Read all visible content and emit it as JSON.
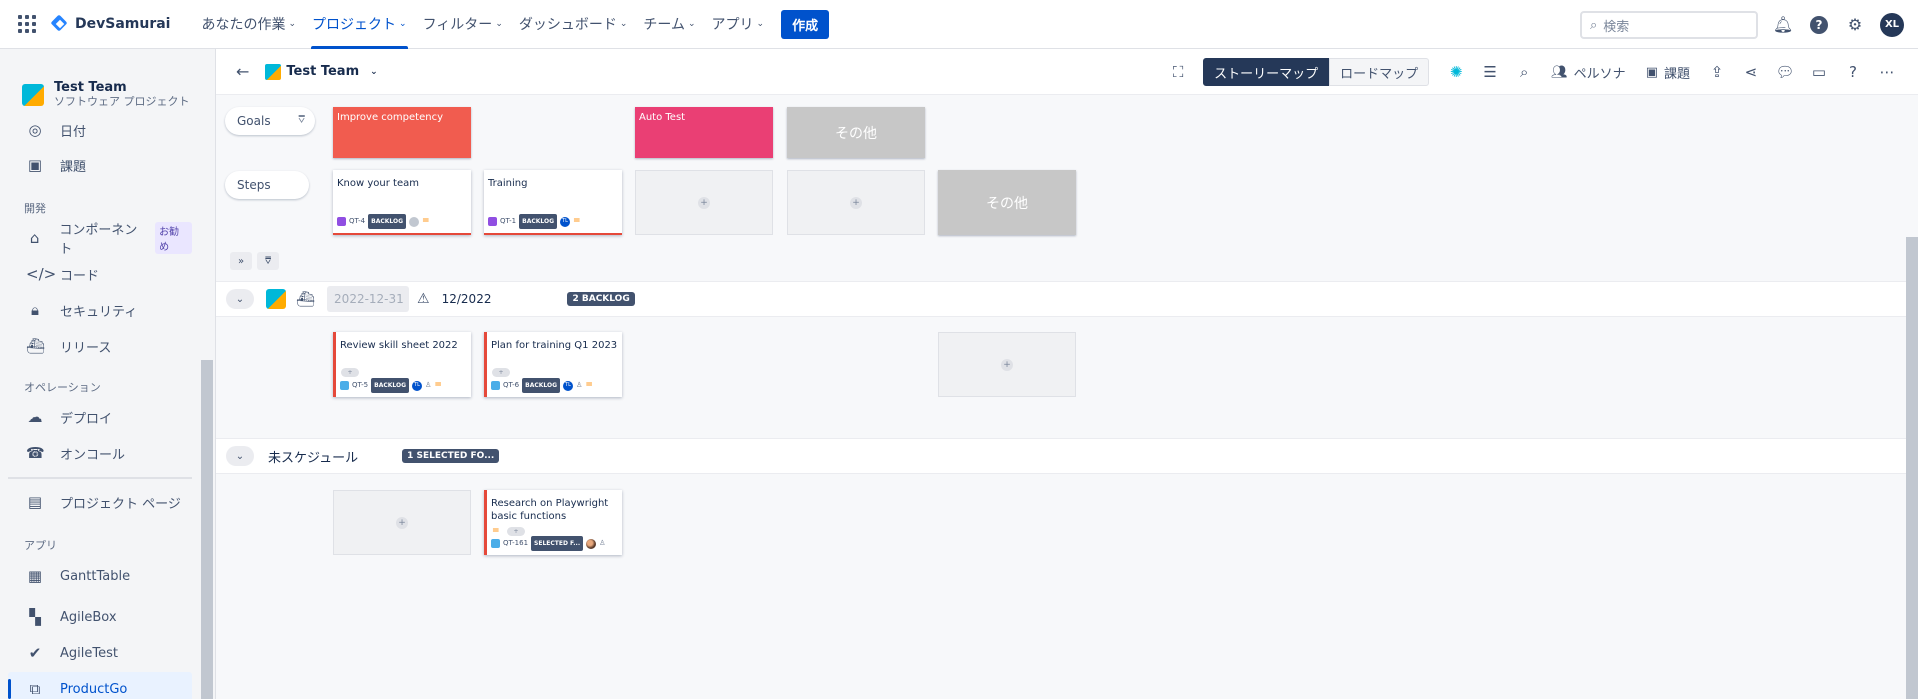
{
  "topnav": {
    "brand": "DevSamurai",
    "items": [
      {
        "label": "あなたの作業",
        "active": false
      },
      {
        "label": "プロジェクト",
        "active": true
      },
      {
        "label": "フィルター",
        "active": false
      },
      {
        "label": "ダッシュボード",
        "active": false
      },
      {
        "label": "チーム",
        "active": false
      },
      {
        "label": "アプリ",
        "active": false
      }
    ],
    "create_label": "作成",
    "search_placeholder": "検索",
    "avatar_initials": "XL"
  },
  "sidebar": {
    "project_name": "Test Team",
    "project_type": "ソフトウェア プロジェクト",
    "items": {
      "timeline": "日付",
      "issues": "課題",
      "section_dev": "開発",
      "components": "コンポーネント",
      "components_badge": "お勧め",
      "code": "コード",
      "security": "セキュリティ",
      "releases": "リリース",
      "section_ops": "オペレーション",
      "deployments": "デプロイ",
      "oncall": "オンコール",
      "project_pages": "プロジェクト ページ",
      "section_apps": "アプリ",
      "gantt": "GanttTable",
      "agilebox": "AgileBox",
      "agiletest": "AgileTest",
      "productgo": "ProductGo"
    }
  },
  "header": {
    "project_name": "Test Team",
    "view_storymap": "ストーリーマップ",
    "view_roadmap": "ロードマップ",
    "persona_label": "ペルソナ",
    "issues_label": "課題"
  },
  "board": {
    "goals_label": "Goals",
    "steps_label": "Steps",
    "other_label": "その他",
    "goals": [
      {
        "title": "Improve competency",
        "color": "#f15c4f"
      },
      {
        "title": "Auto Test",
        "color": "#ea3f74"
      }
    ],
    "steps": [
      {
        "title": "Know your team",
        "key": "QT-4",
        "status": "BACKLOG"
      },
      {
        "title": "Training",
        "key": "QT-1",
        "status": "BACKLOG",
        "avatar": "TL"
      }
    ],
    "release": {
      "date_placeholder": "2022-12-31",
      "name": "12/2022",
      "badge": "2 BACKLOG",
      "cards": [
        {
          "title": "Review skill sheet 2022",
          "key": "QT-5",
          "status": "BACKLOG",
          "avatar": "TL"
        },
        {
          "title": "Plan for training Q1 2023",
          "key": "QT-6",
          "status": "BACKLOG",
          "avatar": "TL"
        }
      ]
    },
    "unscheduled": {
      "name": "未スケジュール",
      "badge": "1 SELECTED FO...",
      "cards": [
        {
          "title": "Research on Playwright basic functions",
          "key": "QT-161",
          "status": "SELECTED F..."
        }
      ]
    }
  }
}
